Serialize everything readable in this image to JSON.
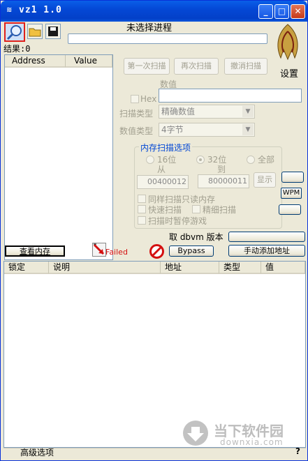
{
  "window": {
    "title": "vz1 1.0",
    "icon": "app-icon"
  },
  "process": {
    "label": "未选择进程",
    "result_label": "结果:0",
    "settings_label": "设置"
  },
  "results_list": {
    "columns": [
      "Address",
      "Value"
    ]
  },
  "scan_buttons": {
    "first": "第一次扫描",
    "next": "再次扫描",
    "undo": "撤消扫描"
  },
  "scan": {
    "value_label": "数值",
    "hex_label": "Hex",
    "scan_type_label": "扫描类型",
    "scan_type_value": "精确数值",
    "value_type_label": "数值类型",
    "value_type_value": "4字节"
  },
  "memory_options": {
    "title": "内存扫描选项",
    "bit16": "16位",
    "bit32": "32位",
    "all": "全部",
    "from_label": "从",
    "to_label": "到",
    "from_value": "00400012",
    "to_value": "80000011",
    "show_button": "显示",
    "same_scan": "同样扫描只读内存",
    "fast_scan": "快速扫描",
    "fine_scan": "精细扫描",
    "pause_game": "扫描时暂停游戏"
  },
  "right_buttons": {
    "wpm": "WPM"
  },
  "dbvm": {
    "label": "取 dbvm 版本"
  },
  "bottom_bar": {
    "view_memory": "查看内存",
    "failed": "Failed",
    "bypass": "Bypass",
    "add_address": "手动添加地址"
  },
  "address_table": {
    "columns": [
      "锁定",
      "说明",
      "地址",
      "类型",
      "值"
    ]
  },
  "footer": {
    "advanced": "高级选项",
    "help": "?"
  },
  "watermark": {
    "brand": "当下软件园",
    "domain": "downxia.com"
  },
  "colors": {
    "titlebar": "#0448d6",
    "accent_red": "#d41010"
  }
}
